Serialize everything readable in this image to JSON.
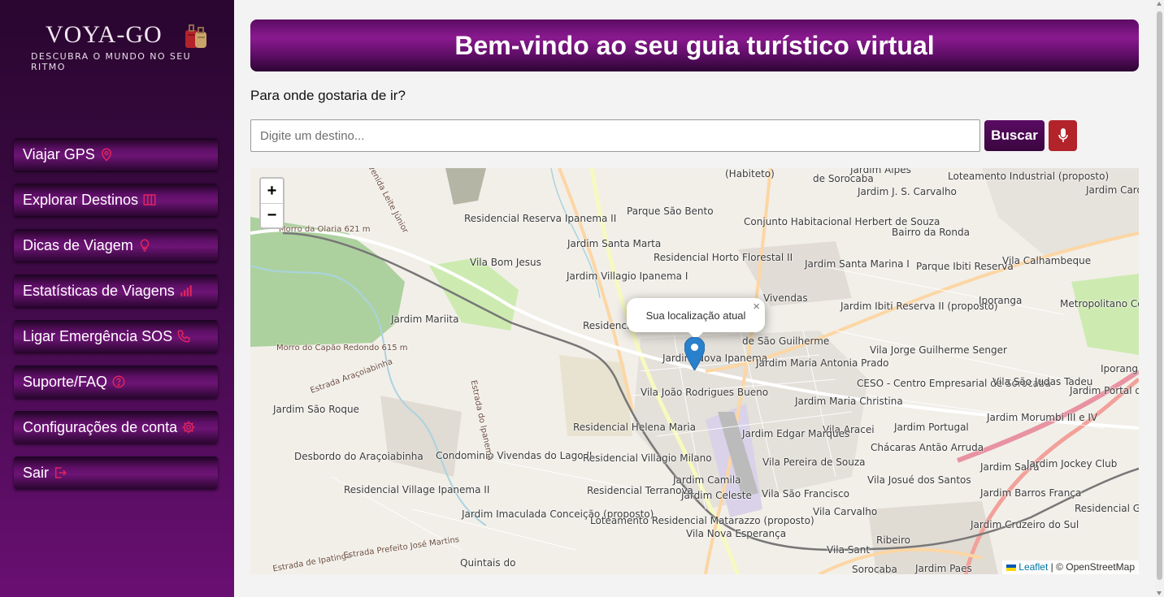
{
  "sidebar": {
    "logo": {
      "title": "VOYA-GO",
      "tagline": "DESCUBRA O MUNDO NO SEU RITMO"
    },
    "items": [
      {
        "label": "Viajar GPS",
        "icon": "map-pin-icon"
      },
      {
        "label": "Explorar Destinos",
        "icon": "map-icon"
      },
      {
        "label": "Dicas de Viagem",
        "icon": "lightbulb-icon"
      },
      {
        "label": "Estatísticas de Viagens",
        "icon": "bar-chart-icon"
      },
      {
        "label": "Ligar Emergência SOS",
        "icon": "phone-icon"
      },
      {
        "label": "Suporte/FAQ",
        "icon": "question-circle-icon"
      },
      {
        "label": "Configurações de conta",
        "icon": "gear-icon"
      },
      {
        "label": "Sair",
        "icon": "logout-icon"
      }
    ],
    "icon_color": "#e0245e"
  },
  "header": {
    "title": "Bem-vindo ao seu guia turístico virtual"
  },
  "search": {
    "question": "Para onde gostaria de ir?",
    "placeholder": "Digite um destino...",
    "button_label": "Buscar",
    "mic_icon": "microphone-icon"
  },
  "map": {
    "zoom_in": "+",
    "zoom_out": "−",
    "popup_text": "Sua localização atual",
    "popup_close": "×",
    "attribution_leaflet": "Leaflet",
    "attribution_rest": "| © OpenStreetMap",
    "labels": [
      "(Habiteto)",
      "Loteamento Industrial (proposto)",
      "Residencial Reserva Ipanema II",
      "Parque São Bento",
      "Conjunto Habitacional Herbert de Souza",
      "Bairro da Ronda",
      "Jardim Santa Marta",
      "Vila Bom Jesus",
      "Residencial Horto Florestal II",
      "Jardim Santa Marina I",
      "Parque Ibiti Reserva",
      "Vila Calhambeque",
      "Jardim Villagio Ipanema I",
      "Morro da Olaria 621 m",
      "Jardim Mariita",
      "Residencial Bosque do Ipanema",
      "Jardim Ibiti Reserva II (proposto)",
      "Iporanga",
      "Metropolitano Condomínio Empresarial",
      "de São Guilherme",
      "Vila Jorge Guilherme Senger",
      "Jardim Nova Ipanema",
      "Jardim Maria Antonia Prado",
      "Morro do Capão Redondo 615 m",
      "Vila João Rodrigues Bueno",
      "CESO - Centro Empresarial de Sorocaba",
      "Vila São Judas Tadeu",
      "Jardim Portal da Primavera",
      "Jardim São Roque",
      "Jardim Maria Christina",
      "Vila Aracei",
      "Jardim Portugal",
      "Jardim Morumbi III e IV",
      "Residencial Helena Maria",
      "Jardim Edgar Marques",
      "Chácaras Antão Arruda",
      "Desbordo do Araçoiabinha",
      "Condominio Vivendas do Lago II",
      "Residencial Villagio Milano",
      "Vila Pereira de Souza",
      "Jardim Saira",
      "Jardim Jockey Club",
      "Residencial Village Ipanema II",
      "Jardim Camila",
      "Jardim Celeste",
      "Vila São Francisco",
      "Vila Josué dos Santos",
      "Jardim Barros França",
      "Residencial Granja Olga I",
      "Residencial Terranova",
      "Vila Carvalho",
      "Jardim Imaculada Conceição (proposto)",
      "Loteamento Residencial Matarazzo (proposto)",
      "Vila Nova Esperança",
      "Ribeiro",
      "Jardim Cruzeiro do Sul",
      "Quintais do",
      "Vila Sant",
      "Sorocaba",
      "Jardim Paes",
      "Jardim Carol II (proposto)",
      "Iporang",
      "Jardim J. S. Carvalho",
      "de Sorocaba",
      "Vivendas",
      "Jardim Alpes"
    ],
    "road_labels": [
      "Estrada Araçoiabinha",
      "Estrada do Ipanema",
      "Estrada de Ipatinga",
      "Estrada Prefeito José Martins",
      "Avenida Leite Júnior"
    ]
  },
  "colors": {
    "brand": "#5a0b63",
    "mic_button": "#b3232a",
    "marker": "#2a81cb"
  }
}
